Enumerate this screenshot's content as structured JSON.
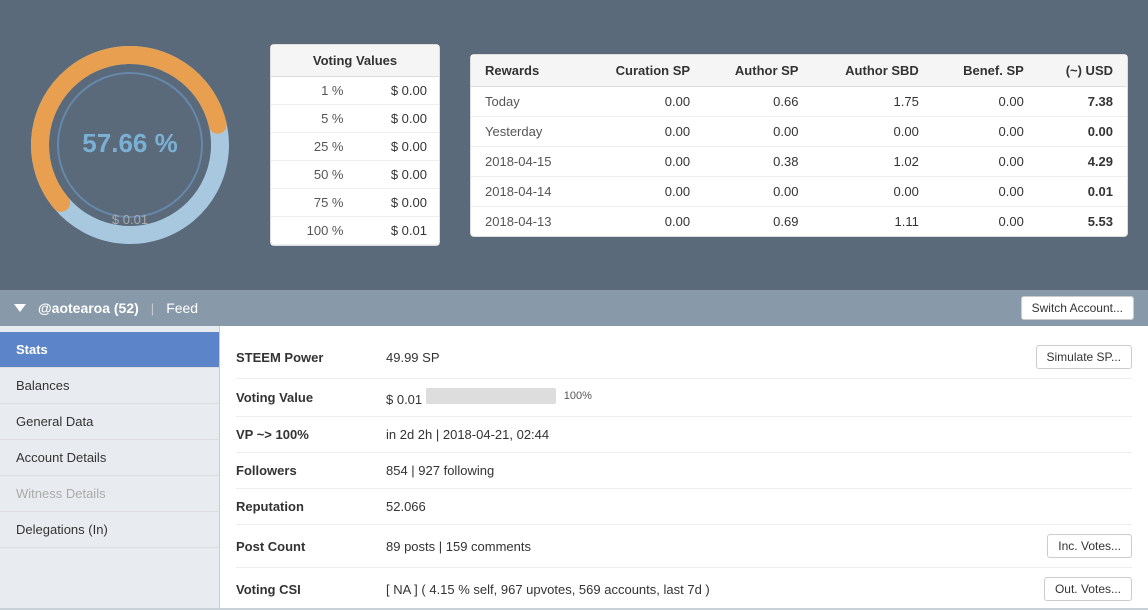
{
  "gauge": {
    "percent": "57.66 %",
    "bottom": "$ 0.01",
    "value": 57.66
  },
  "voting_values": {
    "header": "Voting Values",
    "rows": [
      {
        "pct": "1 %",
        "val": "$ 0.00"
      },
      {
        "pct": "5 %",
        "val": "$ 0.00"
      },
      {
        "pct": "25 %",
        "val": "$ 0.00"
      },
      {
        "pct": "50 %",
        "val": "$ 0.00"
      },
      {
        "pct": "75 %",
        "val": "$ 0.00"
      },
      {
        "pct": "100 %",
        "val": "$ 0.01"
      }
    ]
  },
  "rewards": {
    "headers": [
      "Rewards",
      "Curation SP",
      "Author SP",
      "Author SBD",
      "Benef. SP",
      "(~) USD"
    ],
    "rows": [
      {
        "label": "Today",
        "curation": "0.00",
        "author_sp": "0.66",
        "author_sbd": "1.75",
        "benef": "0.00",
        "usd": "7.38",
        "usd_bold": true
      },
      {
        "label": "Yesterday",
        "curation": "0.00",
        "author_sp": "0.00",
        "author_sbd": "0.00",
        "benef": "0.00",
        "usd": "0.00",
        "usd_bold": true
      },
      {
        "label": "2018-04-15",
        "curation": "0.00",
        "author_sp": "0.38",
        "author_sbd": "1.02",
        "benef": "0.00",
        "usd": "4.29",
        "usd_bold": true
      },
      {
        "label": "2018-04-14",
        "curation": "0.00",
        "author_sp": "0.00",
        "author_sbd": "0.00",
        "benef": "0.00",
        "usd": "0.01",
        "usd_bold": true
      },
      {
        "label": "2018-04-13",
        "curation": "0.00",
        "author_sp": "0.69",
        "author_sbd": "1.11",
        "benef": "0.00",
        "usd": "5.53",
        "usd_bold": true
      }
    ]
  },
  "account_bar": {
    "account": "@aotearoa (52)",
    "separator": "|",
    "feed": "Feed",
    "switch_btn": "Switch Account..."
  },
  "sidebar": {
    "items": [
      {
        "id": "stats",
        "label": "Stats",
        "active": true,
        "disabled": false
      },
      {
        "id": "balances",
        "label": "Balances",
        "active": false,
        "disabled": false
      },
      {
        "id": "general-data",
        "label": "General Data",
        "active": false,
        "disabled": false
      },
      {
        "id": "account-details",
        "label": "Account Details",
        "active": false,
        "disabled": false
      },
      {
        "id": "witness-details",
        "label": "Witness Details",
        "active": false,
        "disabled": true
      },
      {
        "id": "delegations-in",
        "label": "Delegations (In)",
        "active": false,
        "disabled": false
      }
    ]
  },
  "stats": {
    "rows": [
      {
        "id": "steem-power",
        "label": "STEEM Power",
        "value": "49.99 SP",
        "action_label": "Simulate SP...",
        "has_action": true
      },
      {
        "id": "voting-value",
        "label": "Voting Value",
        "value": "$ 0.01",
        "has_progress": true,
        "progress_pct": 100,
        "progress_label": "100%",
        "has_action": false
      },
      {
        "id": "vp-100",
        "label": "VP ~> 100%",
        "value": "in 2d 2h | 2018-04-21, 02:44",
        "has_action": false
      },
      {
        "id": "followers",
        "label": "Followers",
        "value": "854 | 927 following",
        "has_action": false
      },
      {
        "id": "reputation",
        "label": "Reputation",
        "value": "52.066",
        "has_action": false
      },
      {
        "id": "post-count",
        "label": "Post Count",
        "value": "89 posts | 159 comments",
        "action_label": "Inc. Votes...",
        "has_action": true
      },
      {
        "id": "voting-csi",
        "label": "Voting CSI",
        "value": "[ NA ] ( 4.15 % self, 967 upvotes, 569 accounts, last 7d )",
        "action_label": "Out. Votes...",
        "has_action": true
      }
    ]
  }
}
